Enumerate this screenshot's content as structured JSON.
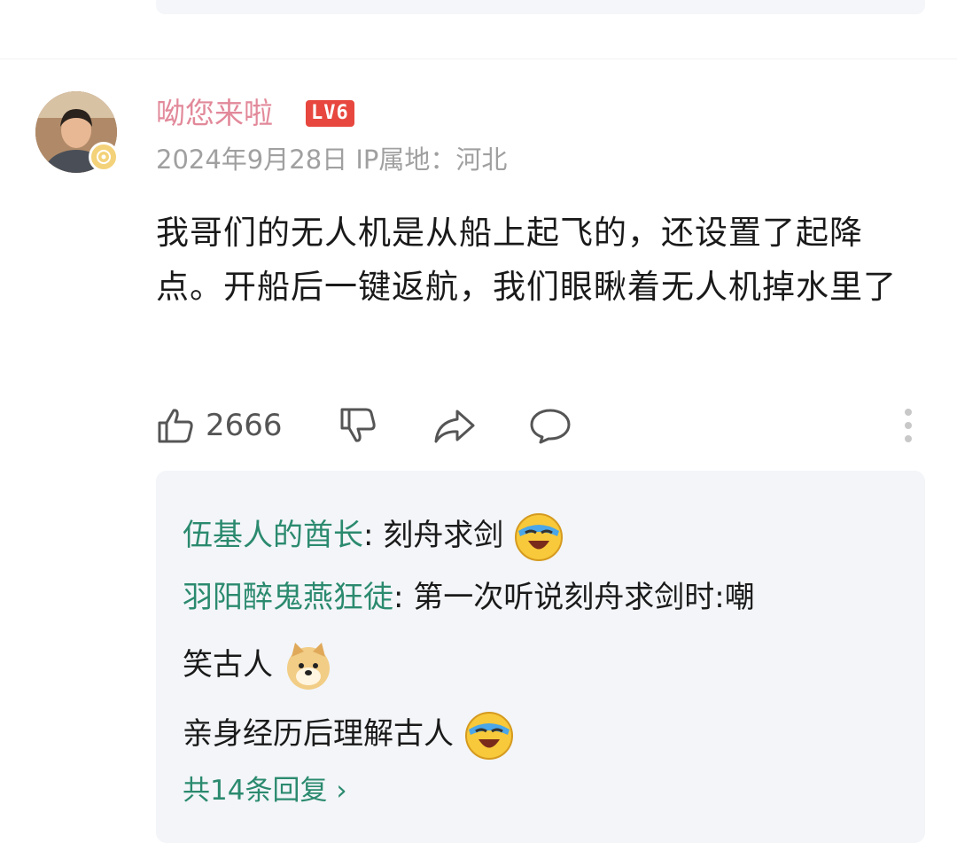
{
  "comment": {
    "username": "呦您来啦",
    "level_badge": "LV6",
    "meta": "2024年9月28日 IP属地：河北",
    "content": "我哥们的无人机是从船上起飞的，还设置了起降点。开船后一键返航，我们眼瞅着无人机掉水里了",
    "likes": "2666",
    "icons": [
      "thumbs-up-icon",
      "thumbs-down-icon",
      "share-icon",
      "comment-icon",
      "more-vertical-icon"
    ]
  },
  "replies": {
    "items": [
      {
        "author": "伍基人的酋长",
        "separator": ": ",
        "text": "刻舟求剑",
        "emoji": "laughing-tears-emoji"
      },
      {
        "author": "羽阳醉鬼燕狂徒",
        "separator": ": ",
        "text": "第一次听说刻舟求剑时:嘲",
        "text_cont": "笑古人",
        "emoji": "doge-emoji",
        "text_line3": "亲身经历后理解古人",
        "emoji2": "laughing-tears-emoji"
      }
    ],
    "more_label": "共14条回复 ›"
  },
  "colors": {
    "username": "#e2899a",
    "level_badge": "#e7473e",
    "reply_author": "#2b8a6e",
    "reply_bg": "#f3f5f8"
  }
}
